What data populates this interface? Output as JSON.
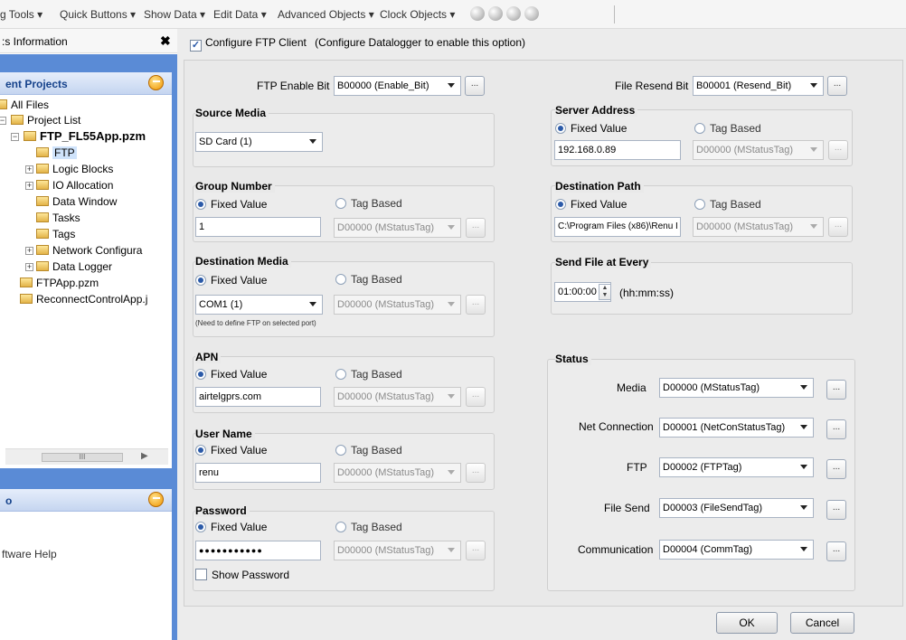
{
  "menu": {
    "items": [
      "g Tools ▾",
      "Quick Buttons ▾",
      "Show Data ▾",
      "Edit Data ▾",
      "Advanced Objects ▾",
      "Clock Objects ▾"
    ]
  },
  "left": {
    "info_title": ":s Information",
    "close": "✖",
    "projects_title": "ent Projects",
    "tree": {
      "all_files": "All Files",
      "project_list": "Project List",
      "project": "FTP_FL55App.pzm",
      "ftp": "FTP",
      "logic": "Logic Blocks",
      "io": "IO Allocation",
      "datawin": "Data Window",
      "tasks": "Tasks",
      "tags": "Tags",
      "netconf": "Network Configura",
      "datalog": "Data Logger",
      "ftpapp": "FTPApp.pzm",
      "reconnect": "ReconnectControlApp.j"
    },
    "scroll_mark": "III",
    "scroll_arrow": "▶",
    "help_title": "o",
    "help_link": "ftware Help"
  },
  "dialog": {
    "configure_label": "Configure FTP Client",
    "configure_note": "(Configure Datalogger to enable this option)",
    "ftp_enable_bit_label": "FTP Enable Bit",
    "ftp_enable_bit_value": "B00000 (Enable_Bit)",
    "file_resend_bit_label": "File Resend Bit",
    "file_resend_bit_value": "B00001 (Resend_Bit)",
    "dots": "...",
    "source_media": {
      "title": "Source Media",
      "value": "SD Card (1)"
    },
    "group_number": {
      "title": "Group Number",
      "fixed": "Fixed Value",
      "tag": "Tag Based",
      "value": "1",
      "tag_value": "D00000 (MStatusTag)"
    },
    "destination_media": {
      "title": "Destination Media",
      "fixed": "Fixed Value",
      "tag": "Tag Based",
      "value": "COM1 (1)",
      "tag_value": "D00000 (MStatusTag)",
      "note": "(Need to define FTP on selected port)"
    },
    "apn": {
      "title": "APN",
      "fixed": "Fixed Value",
      "tag": "Tag Based",
      "value": "airtelgprs.com",
      "tag_value": "D00000 (MStatusTag)"
    },
    "user_name": {
      "title": "User Name",
      "fixed": "Fixed Value",
      "tag": "Tag Based",
      "value": "renu",
      "tag_value": "D00000 (MStatusTag)"
    },
    "password": {
      "title": "Password",
      "fixed": "Fixed Value",
      "tag": "Tag Based",
      "value": "●●●●●●●●●●●",
      "tag_value": "D00000 (MStatusTag)",
      "show": "Show Password"
    },
    "server_address": {
      "title": "Server Address",
      "fixed": "Fixed Value",
      "tag": "Tag Based",
      "value": "192.168.0.89",
      "tag_value": "D00000 (MStatusTag)"
    },
    "destination_path": {
      "title": "Destination Path",
      "fixed": "Fixed Value",
      "tag": "Tag Based",
      "value": "C:\\Program Files (x86)\\Renu I",
      "tag_value": "D00000 (MStatusTag)"
    },
    "send_file": {
      "title": "Send File at Every",
      "value": "01:00:00",
      "unit": "(hh:mm:ss)"
    },
    "status": {
      "title": "Status",
      "rows": [
        {
          "label": "Media",
          "value": "D00000 (MStatusTag)"
        },
        {
          "label": "Net Connection",
          "value": "D00001 (NetConStatusTag)"
        },
        {
          "label": "FTP",
          "value": "D00002 (FTPTag)"
        },
        {
          "label": "File Send",
          "value": "D00003 (FileSendTag)"
        },
        {
          "label": "Communication",
          "value": "D00004 (CommTag)"
        }
      ]
    },
    "ok": "OK",
    "cancel": "Cancel"
  }
}
